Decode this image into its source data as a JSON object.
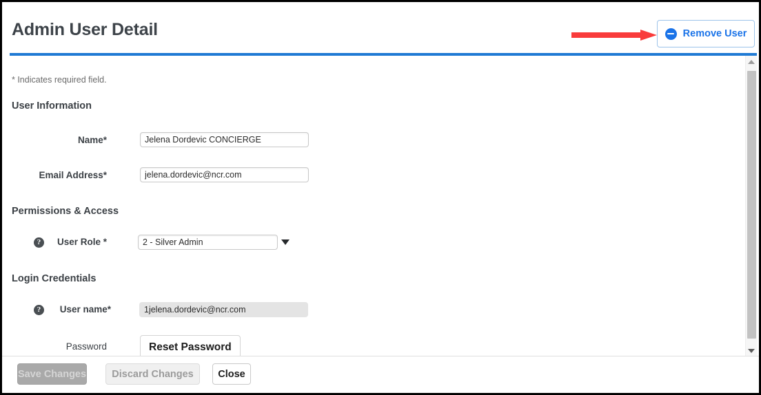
{
  "header": {
    "title": "Admin User Detail",
    "remove_user_label": "Remove User",
    "accent_color": "#1f7ad4",
    "button_text_color": "#1a73e8",
    "annotation_arrow_color": "#f93b3b"
  },
  "form": {
    "required_note": "* Indicates required field.",
    "sections": [
      {
        "heading": "User Information",
        "fields": [
          {
            "label": "Name*",
            "value": "Jelena Dordevic CONCIERGE",
            "type": "text",
            "help": false,
            "disabled": false
          },
          {
            "label": "Email Address*",
            "value": "jelena.dordevic@ncr.com",
            "type": "text",
            "help": false,
            "disabled": false
          }
        ]
      },
      {
        "heading": "Permissions & Access",
        "fields": [
          {
            "label": "User Role *",
            "value": "2 - Silver Admin",
            "type": "select",
            "help": true,
            "help_glyph": "?",
            "disabled": false
          }
        ]
      },
      {
        "heading": "Login Credentials",
        "fields": [
          {
            "label": "User name*",
            "value": "1jelena.dordevic@ncr.com",
            "type": "text",
            "help": true,
            "help_glyph": "?",
            "disabled": true
          },
          {
            "label": "Password",
            "value": "Reset Password",
            "type": "button",
            "help": false,
            "disabled": false
          }
        ]
      }
    ]
  },
  "footer": {
    "save_label": "Save Changes",
    "discard_label": "Discard Changes",
    "close_label": "Close"
  }
}
